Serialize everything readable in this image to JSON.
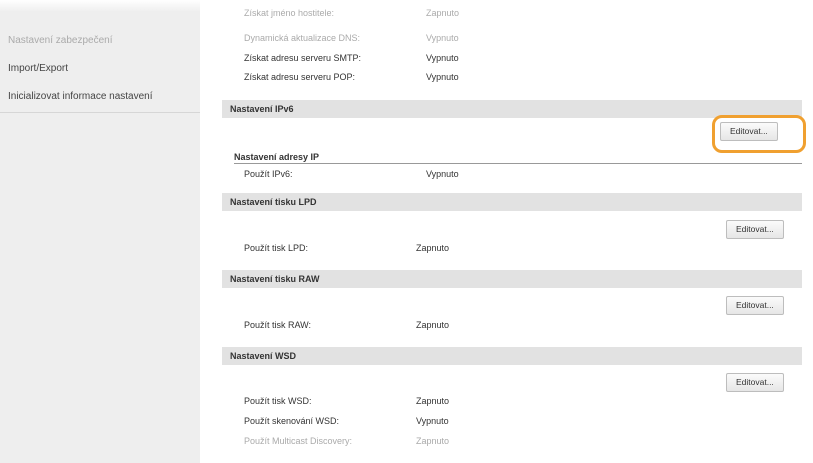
{
  "sidebar": {
    "items": [
      {
        "label": "Nastavení zabezpečení"
      },
      {
        "label": "Import/Export"
      },
      {
        "label": "Inicializovat informace nastavení"
      }
    ]
  },
  "top_rows": [
    {
      "label": "Získat jméno hostitele:",
      "value": "Zapnuto"
    },
    {
      "label": "Dynamická aktualizace DNS:",
      "value": "Vypnuto"
    },
    {
      "label": "Získat adresu serveru SMTP:",
      "value": "Vypnuto"
    },
    {
      "label": "Získat adresu serveru POP:",
      "value": "Vypnuto"
    }
  ],
  "ipv6": {
    "title": "Nastavení IPv6",
    "edit_label": "Editovat...",
    "subhead": "Nastavení adresy IP",
    "row": {
      "label": "Použít IPv6:",
      "value": "Vypnuto"
    }
  },
  "lpd": {
    "title": "Nastavení tisku LPD",
    "edit_label": "Editovat...",
    "row": {
      "label": "Použít tisk LPD:",
      "value": "Zapnuto"
    }
  },
  "raw": {
    "title": "Nastavení tisku RAW",
    "edit_label": "Editovat...",
    "row": {
      "label": "Použít tisk RAW:",
      "value": "Zapnuto"
    }
  },
  "wsd": {
    "title": "Nastavení WSD",
    "edit_label": "Editovat...",
    "rows": [
      {
        "label": "Použít tisk WSD:",
        "value": "Zapnuto"
      },
      {
        "label": "Použít skenování WSD:",
        "value": "Vypnuto"
      },
      {
        "label": "Použít Multicast Discovery:",
        "value": "Zapnuto"
      }
    ]
  },
  "colors": {
    "highlight": "#f0a030",
    "section_bg": "#e2e2e2",
    "sidebar_bg": "#eeeeee"
  }
}
